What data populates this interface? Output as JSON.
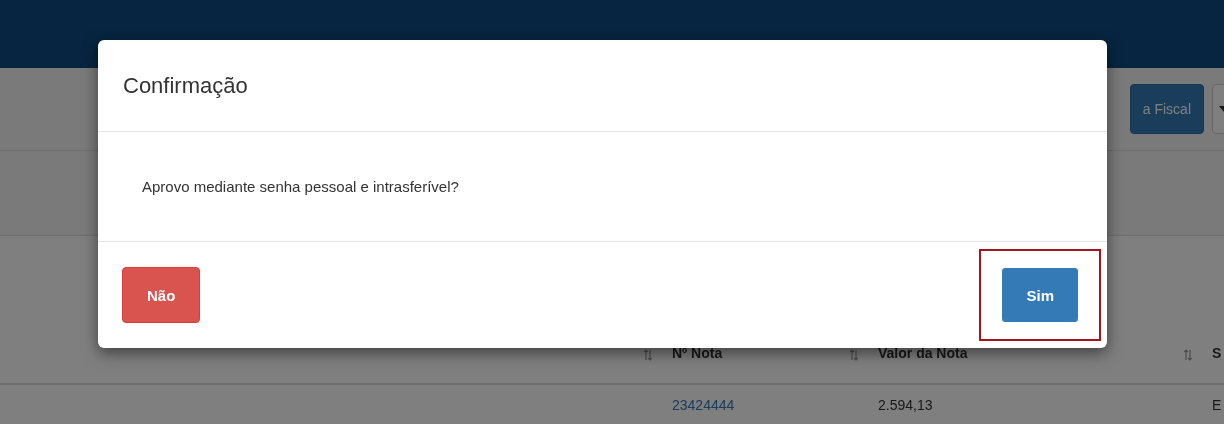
{
  "toolbar": {
    "buttons": [
      {
        "label": "a Fiscal",
        "kind": "primary"
      },
      {
        "kind": "dropdown"
      }
    ]
  },
  "table": {
    "columns": [
      {
        "sortable": true
      },
      {
        "label": "Nº Nota",
        "sortable": true
      },
      {
        "label": "Valor da Nota",
        "sortable": true
      },
      {
        "label": "S",
        "sortable": false
      }
    ],
    "rows": [
      {
        "cells": [
          "",
          "23424444",
          "2.594,13",
          "E"
        ]
      }
    ]
  },
  "dialog": {
    "title": "Confirmação",
    "message": "Aprovo mediante senha pessoal e intrasferível?",
    "buttons": [
      {
        "label": "Não",
        "kind": "danger",
        "highlighted": false
      },
      {
        "label": "Sim",
        "kind": "primary",
        "highlighted": true
      }
    ]
  }
}
